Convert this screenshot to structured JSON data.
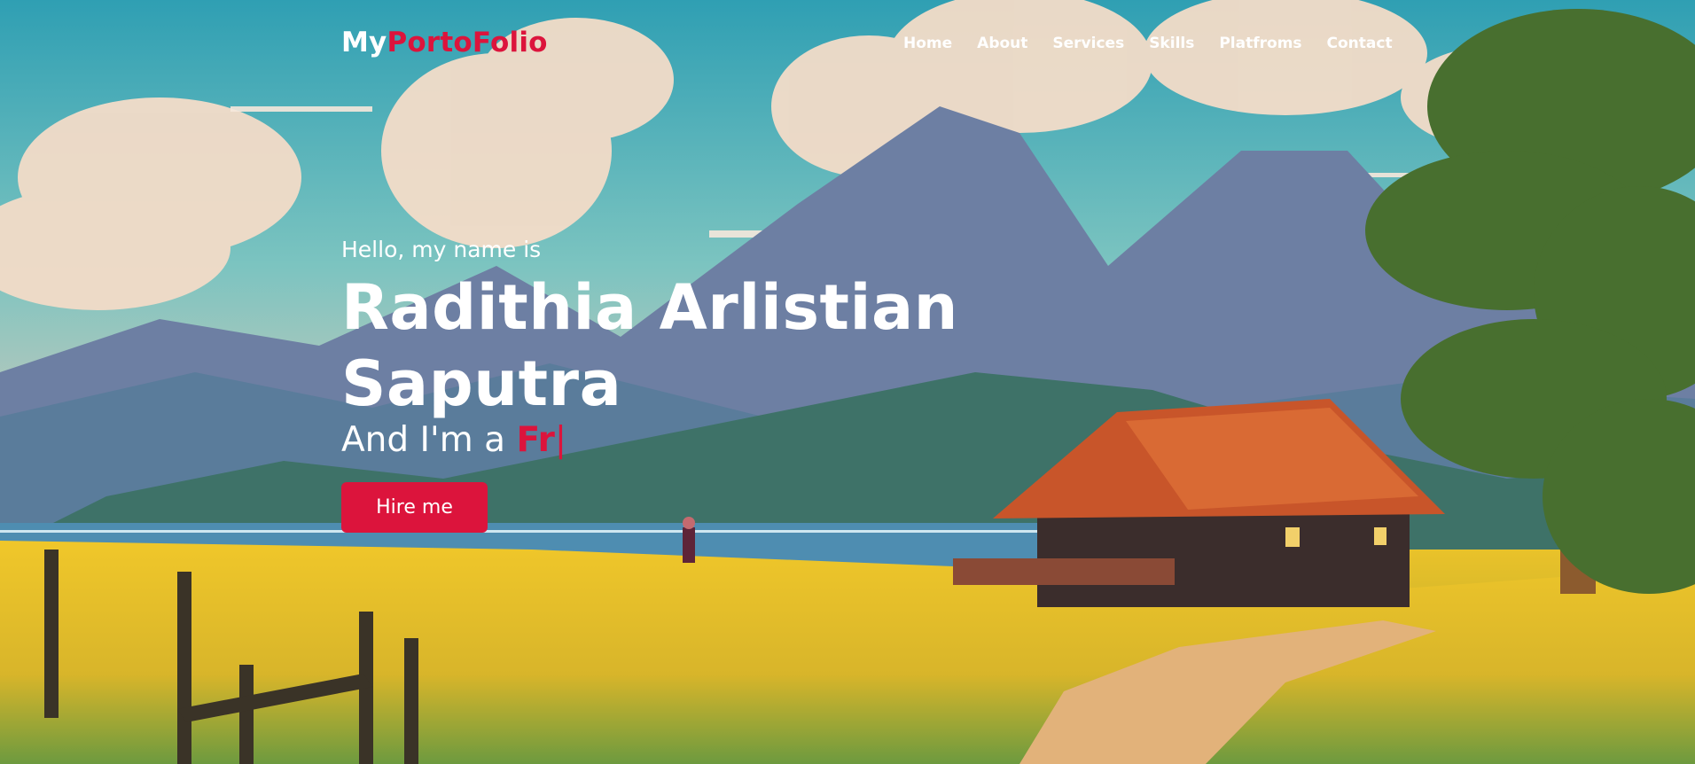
{
  "navbar": {
    "logo_prefix": "My",
    "logo_accent": "PortoFolio",
    "menu": [
      {
        "label": "Home"
      },
      {
        "label": "About"
      },
      {
        "label": "Services"
      },
      {
        "label": "Skills"
      },
      {
        "label": "Platfroms"
      },
      {
        "label": "Contact"
      }
    ]
  },
  "hero": {
    "greeting": "Hello, my name is",
    "name": "Radithia Arlistian Saputra",
    "role_prefix": "And I'm a ",
    "typed_text": "Fr",
    "caret": "|",
    "hire_label": "Hire me"
  },
  "colors": {
    "accent": "#dc143c",
    "text": "#ffffff"
  }
}
